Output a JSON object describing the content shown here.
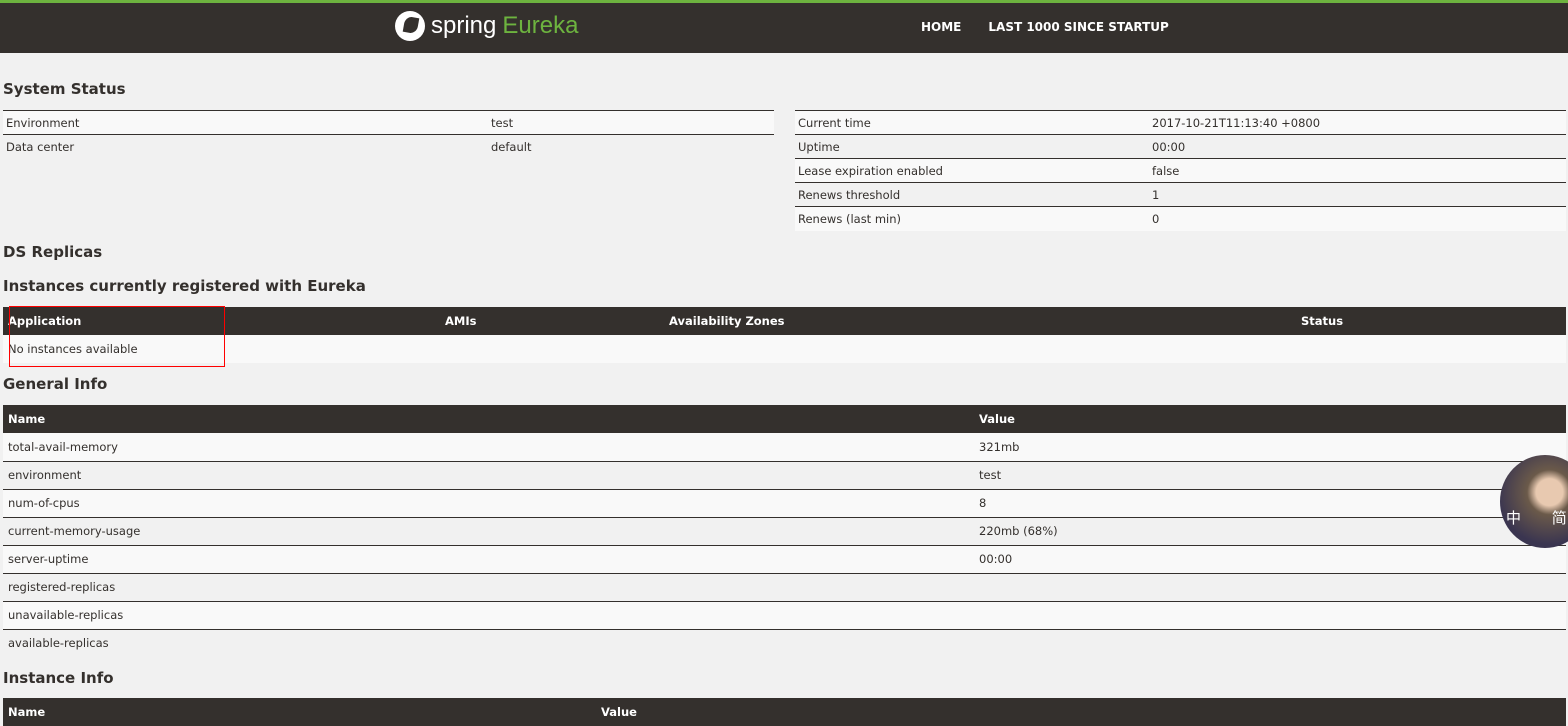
{
  "nav": {
    "brand_spring": "spring",
    "brand_eureka": "Eureka",
    "links": [
      "HOME",
      "LAST 1000 SINCE STARTUP"
    ]
  },
  "system_status": {
    "title": "System Status",
    "left": [
      [
        "Environment",
        "test"
      ],
      [
        "Data center",
        "default"
      ]
    ],
    "right": [
      [
        "Current time",
        "2017-10-21T11:13:40 +0800"
      ],
      [
        "Uptime",
        "00:00"
      ],
      [
        "Lease expiration enabled",
        "false"
      ],
      [
        "Renews threshold",
        "1"
      ],
      [
        "Renews (last min)",
        "0"
      ]
    ]
  },
  "ds_replicas": {
    "title": "DS Replicas"
  },
  "instances": {
    "title": "Instances currently registered with Eureka",
    "headers": [
      "Application",
      "AMIs",
      "Availability Zones",
      "Status"
    ],
    "empty": "No instances available"
  },
  "general_info": {
    "title": "General Info",
    "headers": [
      "Name",
      "Value"
    ],
    "rows": [
      [
        "total-avail-memory",
        "321mb"
      ],
      [
        "environment",
        "test"
      ],
      [
        "num-of-cpus",
        "8"
      ],
      [
        "current-memory-usage",
        "220mb (68%)"
      ],
      [
        "server-uptime",
        "00:00"
      ],
      [
        "registered-replicas",
        ""
      ],
      [
        "unavailable-replicas",
        ""
      ],
      [
        "available-replicas",
        ""
      ]
    ]
  },
  "instance_info": {
    "title": "Instance Info",
    "headers": [
      "Name",
      "Value"
    ]
  },
  "ime_widget": {
    "chars": [
      "中",
      "简"
    ]
  }
}
